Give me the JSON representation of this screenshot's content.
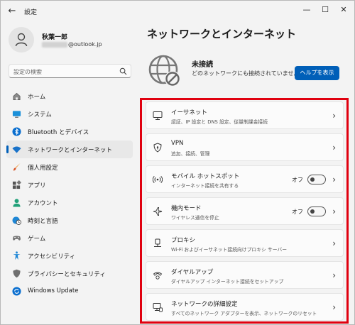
{
  "window": {
    "title": "設定",
    "back_glyph": "←",
    "controls": {
      "minimize": "—",
      "maximize": "☐",
      "close": "✕"
    }
  },
  "profile": {
    "name": "秋葉一郎",
    "email_domain": "@outlook.jp"
  },
  "search": {
    "placeholder": "設定の検索"
  },
  "sidebar": {
    "items": [
      {
        "label": "ホーム",
        "icon": "home-icon"
      },
      {
        "label": "システム",
        "icon": "monitor-icon"
      },
      {
        "label": "Bluetooth とデバイス",
        "icon": "bluetooth-icon"
      },
      {
        "label": "ネットワークとインターネット",
        "icon": "wifi-icon",
        "selected": true
      },
      {
        "label": "個人用設定",
        "icon": "brush-icon"
      },
      {
        "label": "アプリ",
        "icon": "apps-icon"
      },
      {
        "label": "アカウント",
        "icon": "person-icon"
      },
      {
        "label": "時刻と言語",
        "icon": "clock-globe-icon"
      },
      {
        "label": "ゲーム",
        "icon": "gamepad-icon"
      },
      {
        "label": "アクセシビリティ",
        "icon": "accessibility-icon"
      },
      {
        "label": "プライバシーとセキュリティ",
        "icon": "shield-icon"
      },
      {
        "label": "Windows Update",
        "icon": "update-icon"
      }
    ]
  },
  "main": {
    "title": "ネットワークとインターネット",
    "status": {
      "title": "未接続",
      "subtitle": "どのネットワークにも接続されていません。",
      "help_button": "ヘルプを表示"
    },
    "cards": [
      {
        "title": "イーサネット",
        "desc": "認証、IP 設定と DNS 設定、従量制課金接続",
        "icon": "ethernet-icon"
      },
      {
        "title": "VPN",
        "desc": "追加、接続、管理",
        "icon": "vpn-shield-icon"
      },
      {
        "title": "モバイル ホットスポット",
        "desc": "インターネット接続を共有する",
        "icon": "hotspot-icon",
        "toggle": "オフ"
      },
      {
        "title": "機内モード",
        "desc": "ワイヤレス通信を停止",
        "icon": "airplane-icon",
        "toggle": "オフ"
      },
      {
        "title": "プロキシ",
        "desc": "Wi-Fi およびイーサネット接続向けプロキシ サーバー",
        "icon": "proxy-icon"
      },
      {
        "title": "ダイヤルアップ",
        "desc": "ダイヤルアップ インターネット接続をセットアップ",
        "icon": "dialup-icon"
      },
      {
        "title": "ネットワークの詳細設定",
        "desc": "すべてのネットワーク アダプターを表示、ネットワークのリセット",
        "icon": "network-advanced-icon"
      }
    ],
    "chevron": "›"
  },
  "colors": {
    "accent": "#005fb8",
    "highlight": "#e0000f",
    "background": "#f3f3f3"
  }
}
